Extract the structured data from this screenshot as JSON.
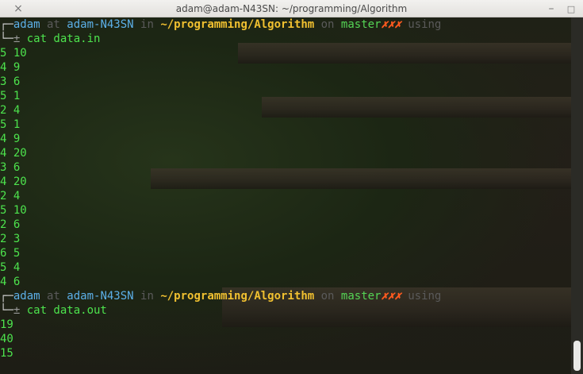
{
  "window": {
    "title": "adam@adam-N43SN: ~/programming/Algorithm",
    "close_icon": "×",
    "minimize_icon": "–",
    "maximize_icon": "□"
  },
  "prompt1": {
    "corner": "┌─",
    "user": "adam",
    "at": " at ",
    "host": "adam-N43SN",
    "in": " in ",
    "path": "~/programming/Algorithm",
    "on": " on ",
    "branch": "master",
    "dirty": "✗✗✗",
    "using": " using",
    "corner2": "└─",
    "pm": "± ",
    "command": "cat data.in"
  },
  "data_in": [
    "5 10",
    "4 9",
    "3 6",
    "5 1",
    "2 4",
    "5 1",
    "4 9",
    "4 20",
    "3 6",
    "4 20",
    "2 4",
    "5 10",
    "2 6",
    "2 3",
    "6 5",
    "5 4",
    "4 6"
  ],
  "prompt2": {
    "corner": "┌─",
    "user": "adam",
    "at": " at ",
    "host": "adam-N43SN",
    "in": " in ",
    "path": "~/programming/Algorithm",
    "on": " on ",
    "branch": "master",
    "dirty": "✗✗✗",
    "using": " using",
    "corner2": "└─",
    "pm": "± ",
    "command": "cat data.out"
  },
  "data_out": [
    "19",
    "40",
    "15"
  ],
  "colors": {
    "text": "#4de34d",
    "user": "#5cb0e8",
    "path": "#f0c030",
    "dirty": "#ff5a1f"
  }
}
